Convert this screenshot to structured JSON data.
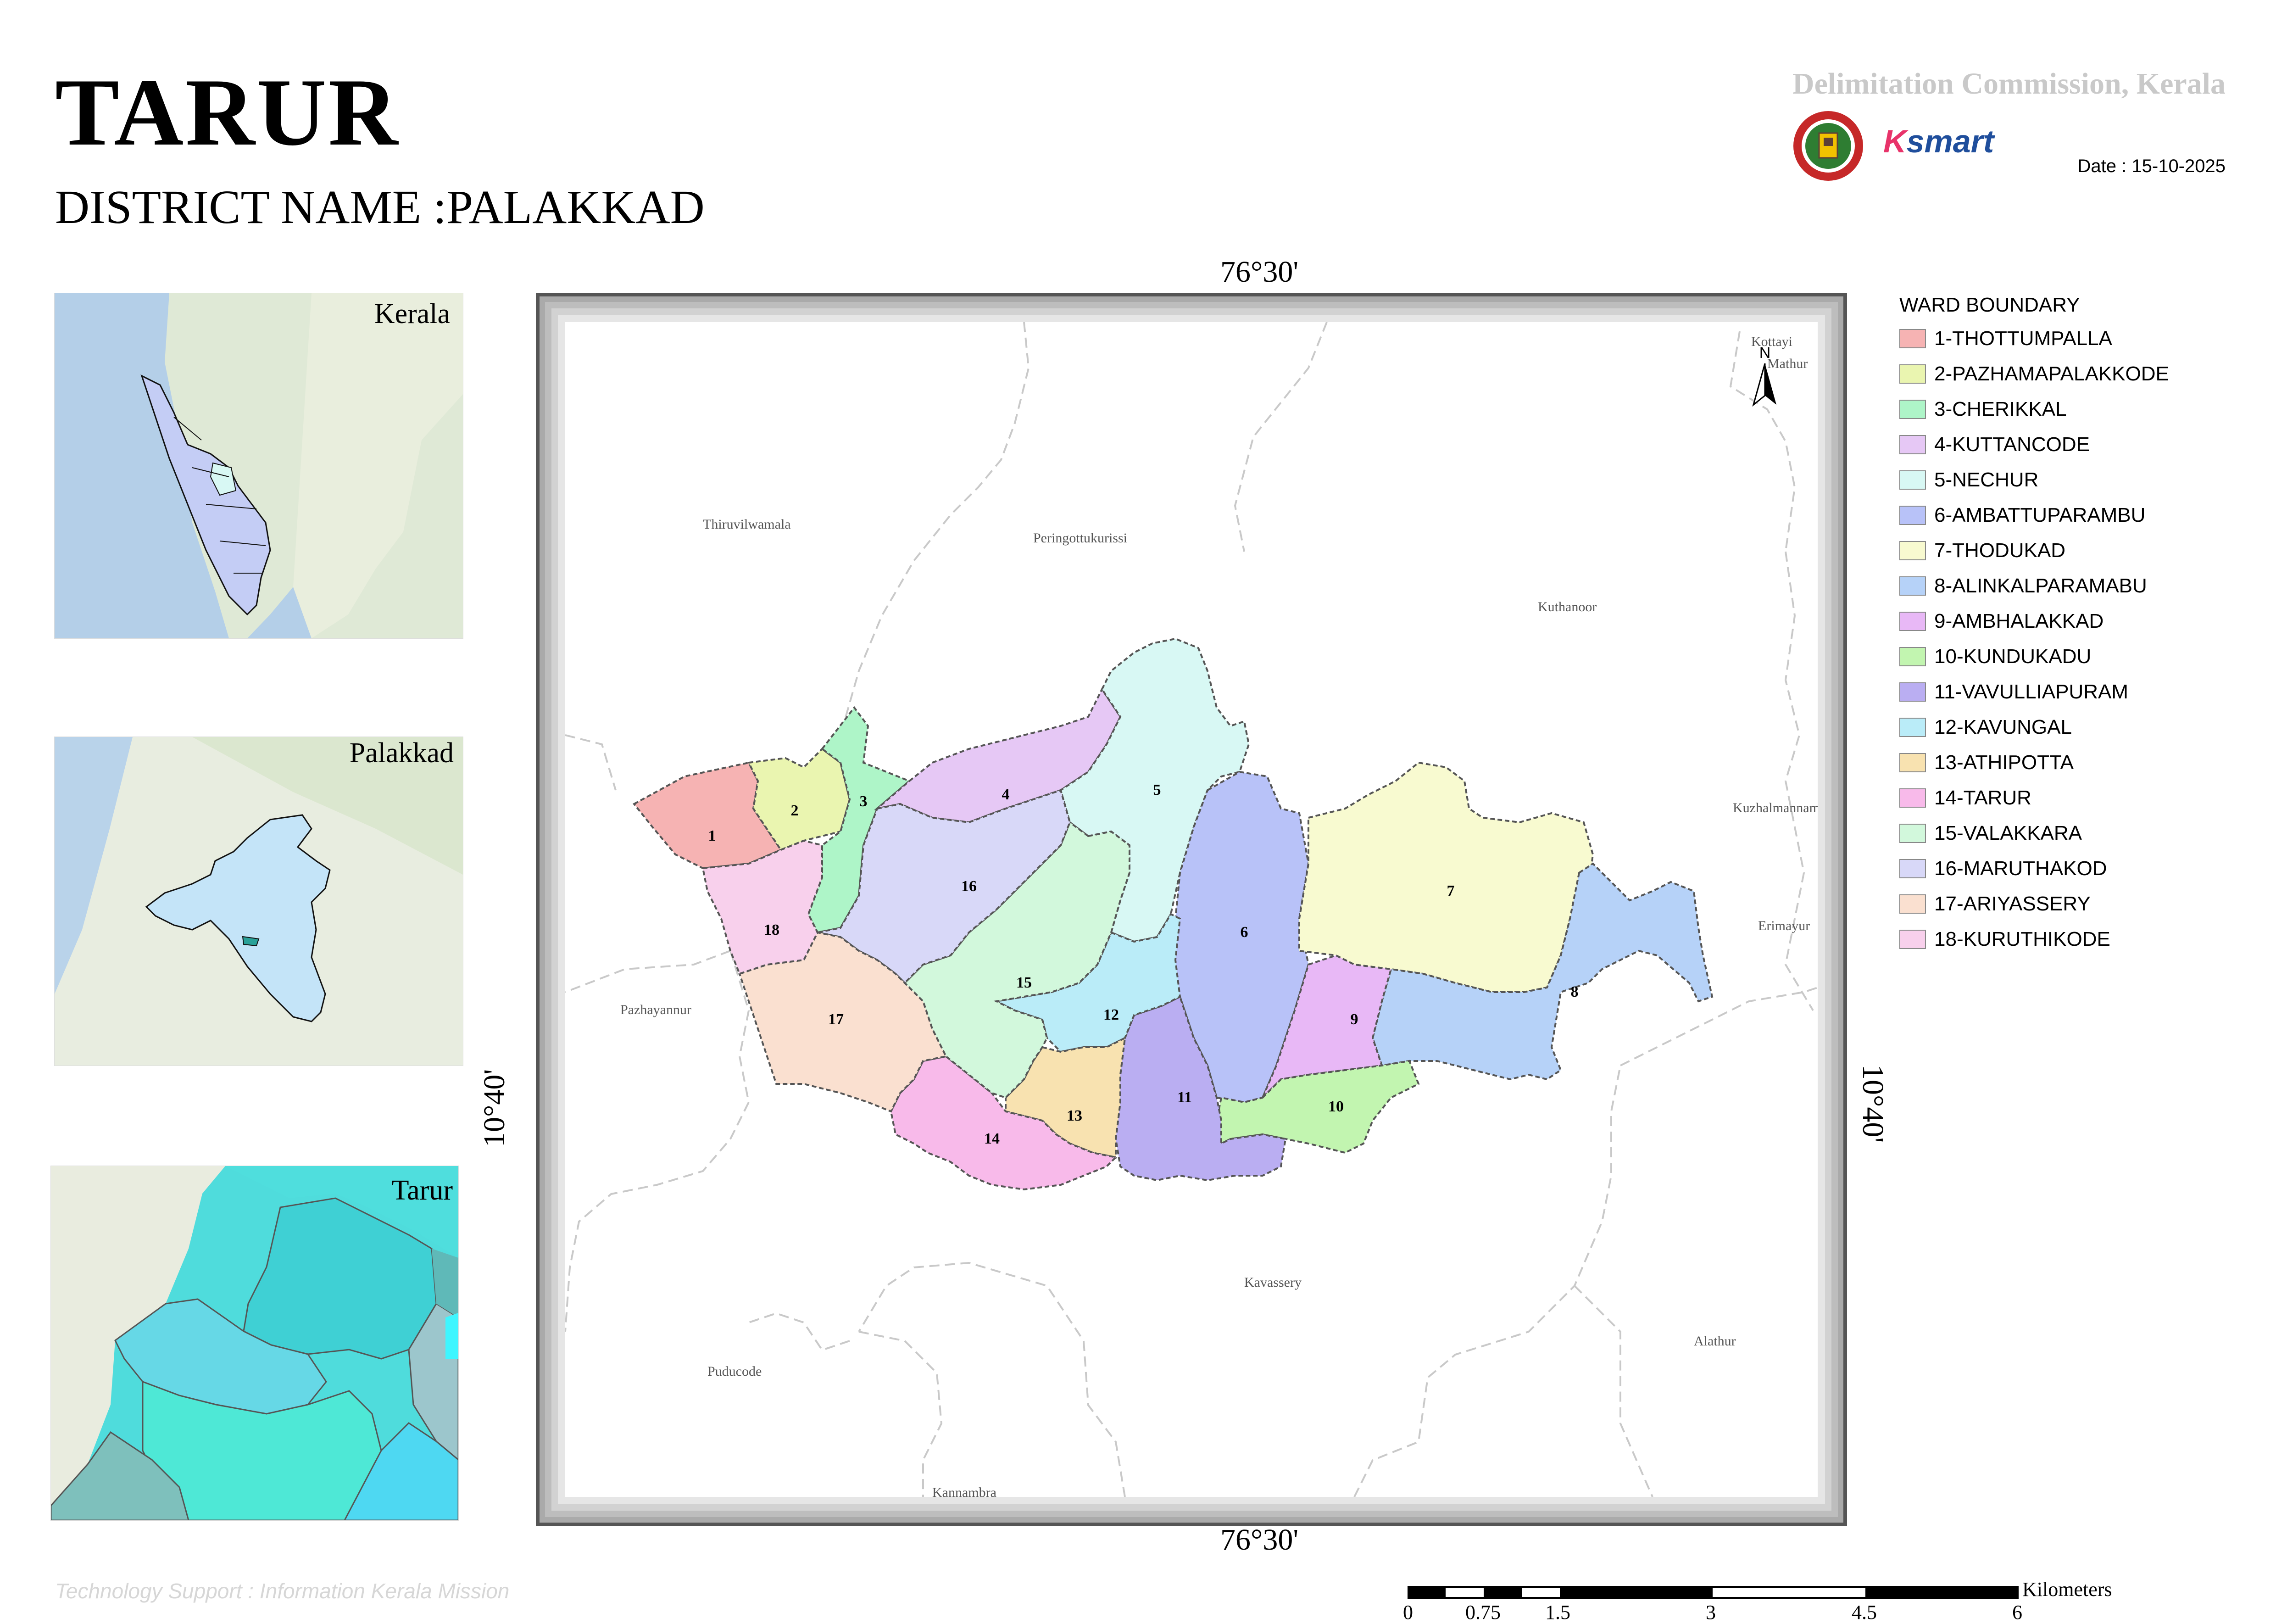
{
  "title": "TARUR",
  "district_label": "DISTRICT NAME :PALAKKAD",
  "commission": "Delimitation Commission, Kerala",
  "date": "Date : 15-10-2025",
  "ksmart_logo": "Ksmart",
  "insets": {
    "kerala": "Kerala",
    "palakkad": "Palakkad",
    "tarur": "Tarur"
  },
  "coords": {
    "top": "76°30'",
    "bottom": "76°30'",
    "left": "10°40'",
    "right": "10°40'"
  },
  "north_label": "N",
  "legend": {
    "title": "WARD BOUNDARY",
    "items": [
      {
        "label": "1-THOTTUMPALLA",
        "color": "#f6b3b3"
      },
      {
        "label": "2-PAZHAMAPALAKKODE",
        "color": "#eaf5b0"
      },
      {
        "label": "3-CHERIKKAL",
        "color": "#aef5c8"
      },
      {
        "label": "4-KUTTANCODE",
        "color": "#e6c8f5"
      },
      {
        "label": "5-NECHUR",
        "color": "#d8f8f4"
      },
      {
        "label": "6-AMBATTUPARAMBU",
        "color": "#b8c2f8"
      },
      {
        "label": "7-THODUKAD",
        "color": "#f8fad0"
      },
      {
        "label": "8-ALINKALPARAMABU",
        "color": "#b6d2f8"
      },
      {
        "label": "9-AMBHALAKKAD",
        "color": "#e8b8f6"
      },
      {
        "label": "10-KUNDUKADU",
        "color": "#c2f5b0"
      },
      {
        "label": "11-VAVULLIAPURAM",
        "color": "#baaef2"
      },
      {
        "label": "12-KAVUNGAL",
        "color": "#baecf8"
      },
      {
        "label": "13-ATHIPOTTA",
        "color": "#f8e2b0"
      },
      {
        "label": "14-TARUR",
        "color": "#f8baea"
      },
      {
        "label": "15-VALAKKARA",
        "color": "#d2f8dc"
      },
      {
        "label": "16-MARUTHAKOD",
        "color": "#d8d8f8"
      },
      {
        "label": "17-ARIYASSERY",
        "color": "#fae0d0"
      },
      {
        "label": "18-KURUTHIKODE",
        "color": "#f8d0ec"
      }
    ]
  },
  "places": {
    "thiruvilwamala": "Thiruvilwamala",
    "peringottukurissi": "Peringottukurissi",
    "kuthanoor": "Kuthanoor",
    "kottayi": "Kottayi",
    "mathur": "Mathur",
    "kuzhalmannam": "Kuzhalmannam",
    "erimayur": "Erimayur",
    "pazhayannur": "Pazhayannur",
    "kavassery": "Kavassery",
    "alathur": "Alathur",
    "puducode": "Puducode",
    "kannambra": "Kannambra"
  },
  "ward_numbers": [
    "1",
    "2",
    "3",
    "4",
    "5",
    "6",
    "7",
    "8",
    "9",
    "10",
    "11",
    "12",
    "13",
    "14",
    "15",
    "16",
    "17",
    "18"
  ],
  "scale": {
    "unit": "Kilometers",
    "ticks": [
      "0",
      "0.75",
      "1.5",
      "3",
      "4.5",
      "6"
    ]
  },
  "tech_support": "Technology Support : Information Kerala Mission"
}
